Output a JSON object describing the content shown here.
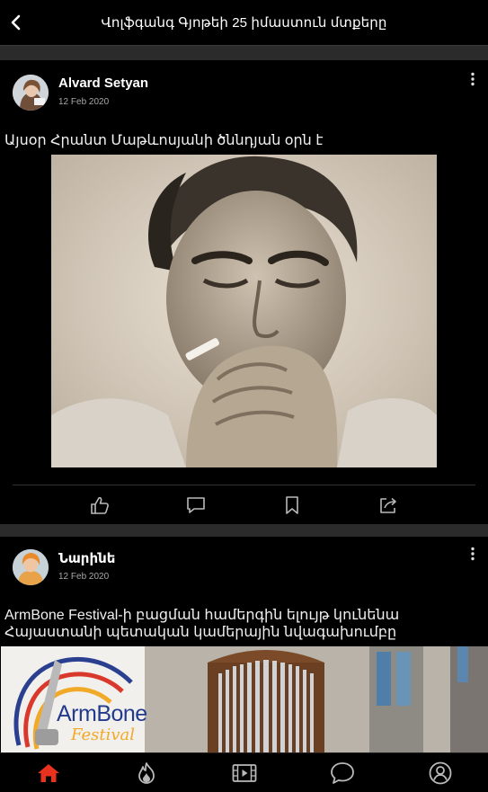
{
  "header": {
    "title": "Վոլֆգանգ Գյոթեի 25 իմաստուն մտքերը"
  },
  "posts": [
    {
      "author": "Alvard Setyan",
      "date": "12 Feb 2020",
      "text": "Այսօր Հրանտ Մաթևոսյանի ծննդյան օրն է",
      "image_desc": "sepia-portrait-photo"
    },
    {
      "author": "Նարինե",
      "date": "12 Feb 2020",
      "text": "ArmBone Festival-ի բացման համերգին ելույթ կունենա Հայաստանի պետական կամերային նվագախումբը",
      "image_logo_text": "ArmBone",
      "image_logo_sub": "Festival"
    }
  ],
  "actions": [
    "like-icon",
    "comment-icon",
    "bookmark-icon",
    "share-icon"
  ],
  "nav": [
    "home-icon",
    "trending-icon",
    "video-icon",
    "chat-icon",
    "profile-icon"
  ],
  "colors": {
    "accent": "#e8321e",
    "icon": "#b9b9b9",
    "background": "#000000",
    "separator": "#2b2b2b"
  }
}
